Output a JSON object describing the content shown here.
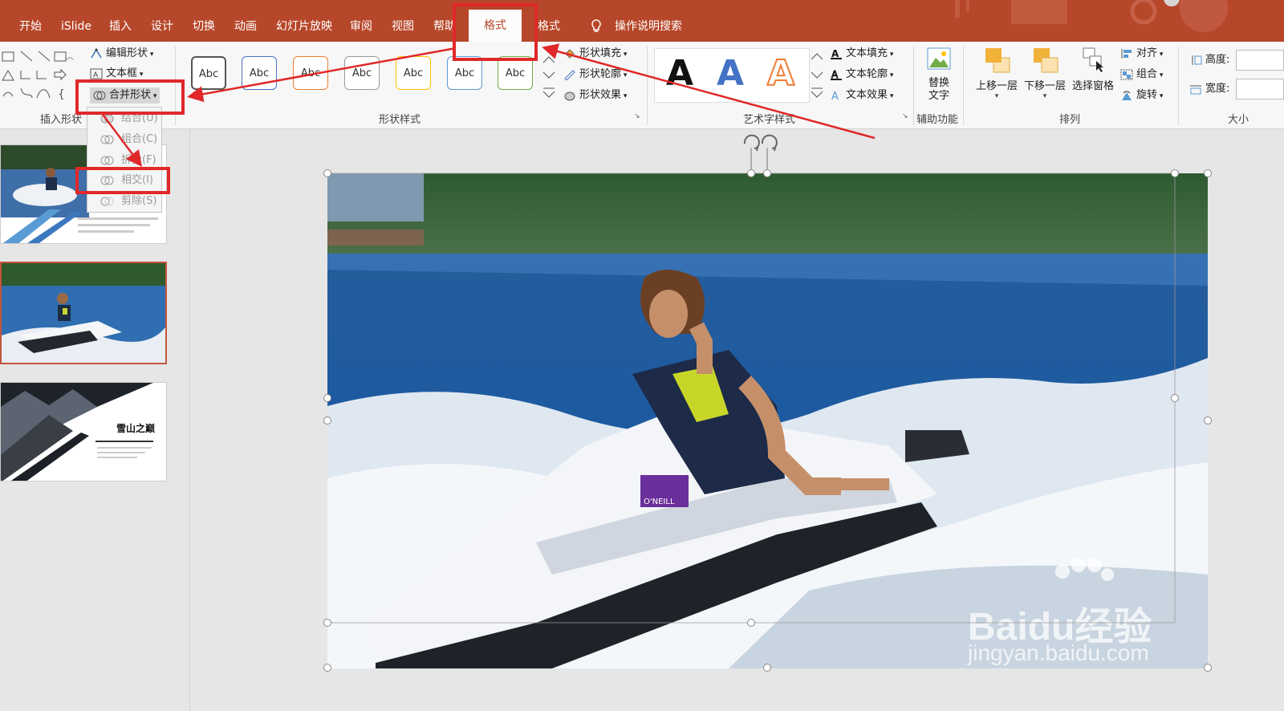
{
  "tabs": [
    {
      "label": "开始"
    },
    {
      "label": "iSlide"
    },
    {
      "label": "插入"
    },
    {
      "label": "设计"
    },
    {
      "label": "切换"
    },
    {
      "label": "动画"
    },
    {
      "label": "幻灯片放映"
    },
    {
      "label": "审阅"
    },
    {
      "label": "视图"
    },
    {
      "label": "帮助"
    },
    {
      "label": "格式"
    },
    {
      "label": "格式"
    }
  ],
  "search_label": "操作说明搜索",
  "insert_shapes": {
    "edit_shape": "编辑形状",
    "text_box": "文本框",
    "merge_shapes": "合并形状",
    "group_label": "插入形状"
  },
  "shape_styles": {
    "abc": [
      "Abc",
      "Abc",
      "Abc",
      "Abc",
      "Abc",
      "Abc",
      "Abc"
    ],
    "fill": "形状填充",
    "outline": "形状轮廓",
    "effect": "形状效果",
    "group_label": "形状样式"
  },
  "wordart": {
    "letters": [
      "A",
      "A",
      "A"
    ],
    "text_fill": "文本填充",
    "text_outline": "文本轮廓",
    "text_effect": "文本效果",
    "group_label": "艺术字样式"
  },
  "accessibility": {
    "alt_text_line1": "替换",
    "alt_text_line2": "文字",
    "group_label": "辅助功能"
  },
  "arrange": {
    "bring_forward": "上移一层",
    "send_backward": "下移一层",
    "selection_pane": "选择窗格",
    "align": "对齐",
    "group": "组合",
    "rotate": "旋转",
    "group_label": "排列"
  },
  "size": {
    "height_label": "高度:",
    "width_label": "宽度:",
    "group_label": "大小"
  },
  "merge_menu": {
    "items": [
      "结合(U)",
      "组合(C)",
      "拆分(F)",
      "相交(I)",
      "剪除(S)"
    ]
  },
  "slides": {
    "slide3_title": "雪山之巅"
  },
  "watermark": {
    "brand": "Baidu经验",
    "url": "jingyan.baidu.com"
  },
  "colors": {
    "accent": "#b7472a",
    "highlight": "#e0282a"
  }
}
